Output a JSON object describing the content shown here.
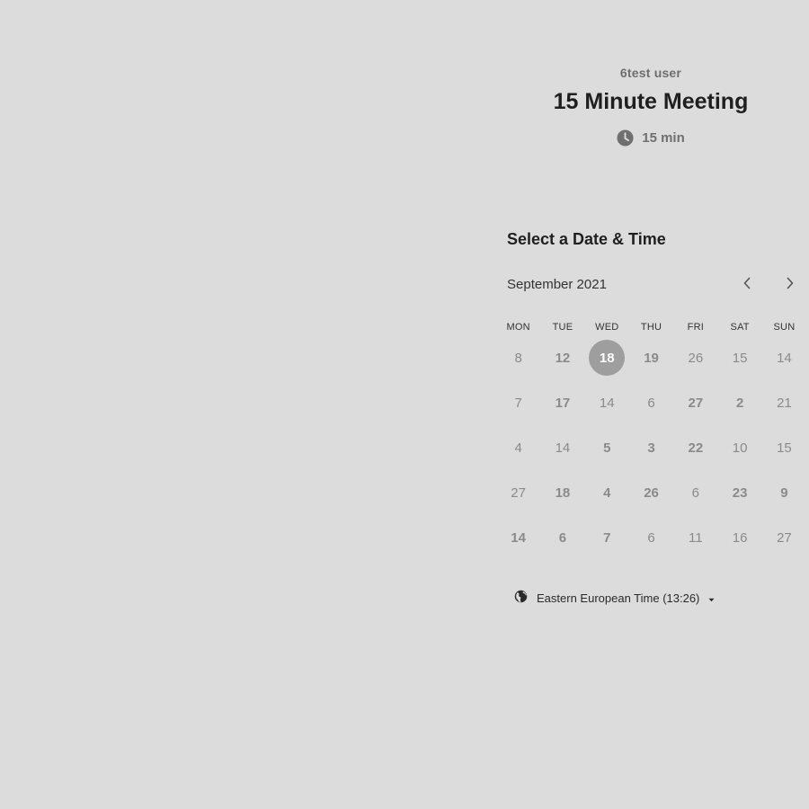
{
  "header": {
    "host": "6test user",
    "title": "15 Minute Meeting",
    "duration": "15 min"
  },
  "section_title": "Select a Date & Time",
  "calendar": {
    "month_label": "September 2021",
    "weekdays": [
      "MON",
      "TUE",
      "WED",
      "THU",
      "FRI",
      "SAT",
      "SUN"
    ],
    "weeks": [
      [
        "8",
        "12",
        "18",
        "19",
        "26",
        "15",
        "14"
      ],
      [
        "7",
        "17",
        "14",
        "6",
        "27",
        "2",
        "21"
      ],
      [
        "4",
        "14",
        "5",
        "3",
        "22",
        "10",
        "15"
      ],
      [
        "27",
        "18",
        "4",
        "26",
        "6",
        "23",
        "9"
      ],
      [
        "14",
        "6",
        "7",
        "6",
        "11",
        "16",
        "27"
      ]
    ],
    "selected_day": "18"
  },
  "timezone": {
    "label": "Eastern European Time (13:26)"
  },
  "colors": {
    "background": "#dcdcdc",
    "selected_day_bg": "#9e9e9e",
    "muted_text": "#8a8a8a"
  }
}
